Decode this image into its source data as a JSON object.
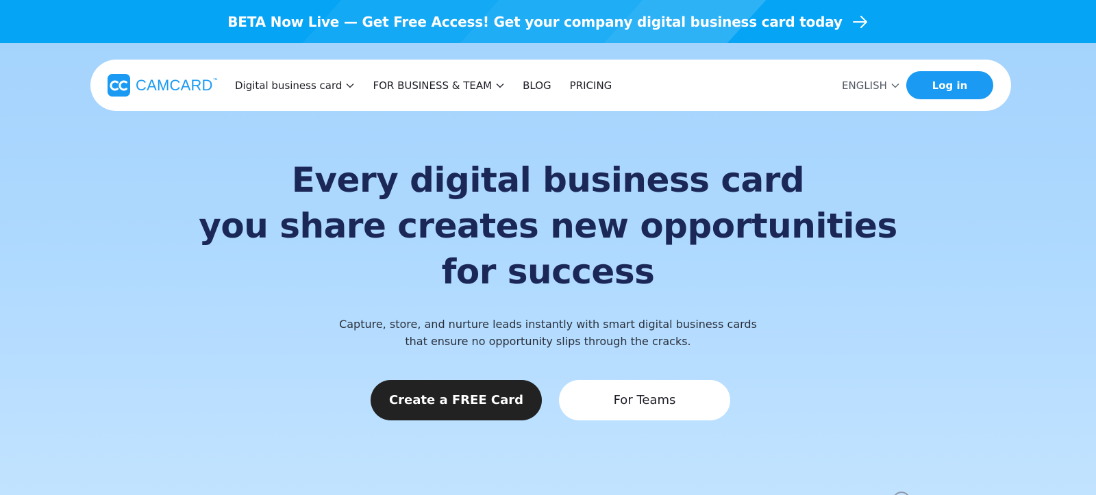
{
  "banner": {
    "text": "BETA Now Live — Get Free Access! Get your company digital business card today",
    "icon": "arrow-right-icon",
    "color": "#06a4f5"
  },
  "nav": {
    "logo_text": "CAMCARD",
    "logo_tm": "™",
    "logo_mark_text": "CC",
    "items": [
      {
        "label": "Digital business card",
        "has_dropdown": true
      },
      {
        "label": "FOR BUSINESS & TEAM",
        "has_dropdown": true
      },
      {
        "label": "BLOG",
        "has_dropdown": false
      },
      {
        "label": "PRICING",
        "has_dropdown": false
      }
    ],
    "language": "ENGLISH",
    "login_label": "Log in",
    "accent": "#1a9af3"
  },
  "hero": {
    "title_lines": [
      "Every digital business card",
      "you share creates new opportunities",
      "for success"
    ],
    "subtitle_lines": [
      "Capture, store, and nurture leads instantly with smart digital business cards",
      "that ensure no opportunity slips through the cracks."
    ],
    "primary_cta": "Create a FREE Card",
    "secondary_cta": "For Teams",
    "title_color": "#1b2857"
  }
}
